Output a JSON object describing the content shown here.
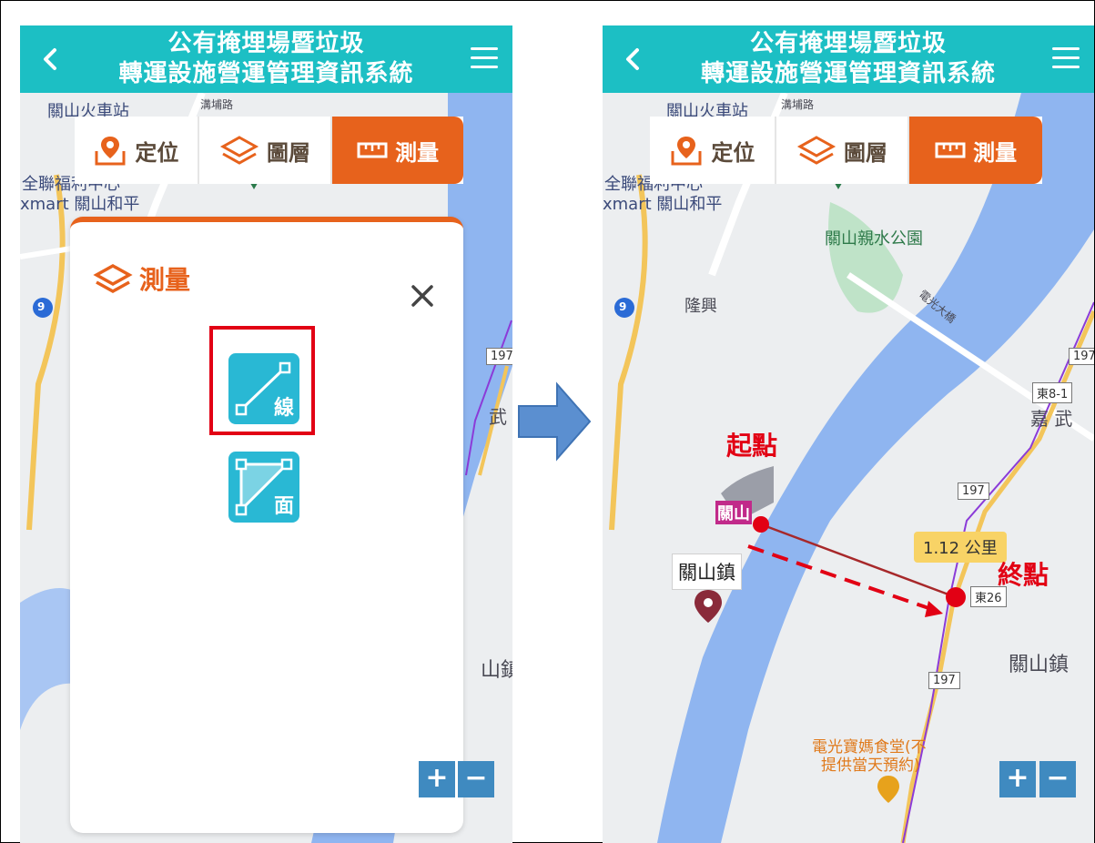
{
  "app": {
    "title_line1": "公有掩埋場暨垃圾",
    "title_line2": "轉運設施營運管理資訊系統"
  },
  "toolbar": {
    "locate_label": "定位",
    "layers_label": "圖層",
    "measure_label": "測量"
  },
  "measure_panel": {
    "title": "測量",
    "line_label": "線",
    "area_label": "面"
  },
  "zoom": {
    "plus": "+",
    "minus": "−"
  },
  "left_map": {
    "labels": {
      "station": "關山火車站",
      "store_line1": "全聯福利中心",
      "store_line2": "xmart 關山和平",
      "road_tag": "197",
      "partial_wu": "武",
      "partial_town": "山鎮",
      "route9": "9",
      "street": "溝埔路"
    }
  },
  "right_map": {
    "labels": {
      "station": "關山火車站",
      "street": "溝埔路",
      "store_line1": "全聯福利中心",
      "store_line2": "xmart 關山和平",
      "park": "關山親水公園",
      "longxing": "隆興",
      "bridge": "電光大橋",
      "road_197a": "197",
      "road_197b": "197",
      "road_197c": "197",
      "road_e81": "東8-1",
      "road_e26": "東26",
      "jiawu": "嘉 武",
      "guanshan_chip": "關山",
      "guanshan_town_pin": "關山鎮",
      "guanshan_town": "關山鎮",
      "restaurant_line1": "電光寶媽食堂(不",
      "restaurant_line2": "提供當天預約)",
      "route9": "9"
    },
    "distance": "1.12 公里",
    "start_annotation": "起點",
    "end_annotation": "終點"
  },
  "colors": {
    "header": "#1cbfc4",
    "accent_orange": "#e7621c",
    "measure_button": "#29b8d4",
    "highlight_red": "#e20014",
    "river": "#8fb5f0",
    "zoom_button": "#3f8ac0",
    "transition_arrow": "#5b8fd0"
  }
}
